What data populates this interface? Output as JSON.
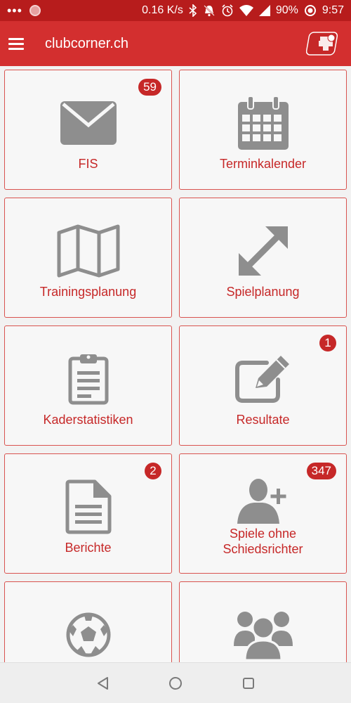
{
  "status_bar": {
    "speed": "0.16 K/s",
    "battery": "90%",
    "time": "9:57"
  },
  "app_bar": {
    "title": "clubcorner.ch"
  },
  "tiles": [
    {
      "label": "FIS",
      "badge": "59",
      "icon": "envelope-icon"
    },
    {
      "label": "Terminkalender",
      "badge": "",
      "icon": "calendar-icon"
    },
    {
      "label": "Trainingsplanung",
      "badge": "",
      "icon": "map-icon"
    },
    {
      "label": "Spielplanung",
      "badge": "",
      "icon": "resize-arrows-icon"
    },
    {
      "label": "Kaderstatistiken",
      "badge": "",
      "icon": "clipboard-icon"
    },
    {
      "label": "Resultate",
      "badge": "1",
      "icon": "edit-icon"
    },
    {
      "label": "Berichte",
      "badge": "2",
      "icon": "document-icon"
    },
    {
      "label_line1": "Spiele ohne",
      "label_line2": "Schiedsrichter",
      "badge": "347",
      "icon": "user-plus-icon"
    },
    {
      "label": "",
      "badge": "",
      "icon": "soccer-ball-icon"
    },
    {
      "label": "",
      "badge": "",
      "icon": "group-icon"
    }
  ],
  "colors": {
    "primary": "#d32f2f",
    "status_bar": "#b71c1c",
    "accent_text": "#c62828",
    "icon_gray": "#8e8e8e"
  }
}
